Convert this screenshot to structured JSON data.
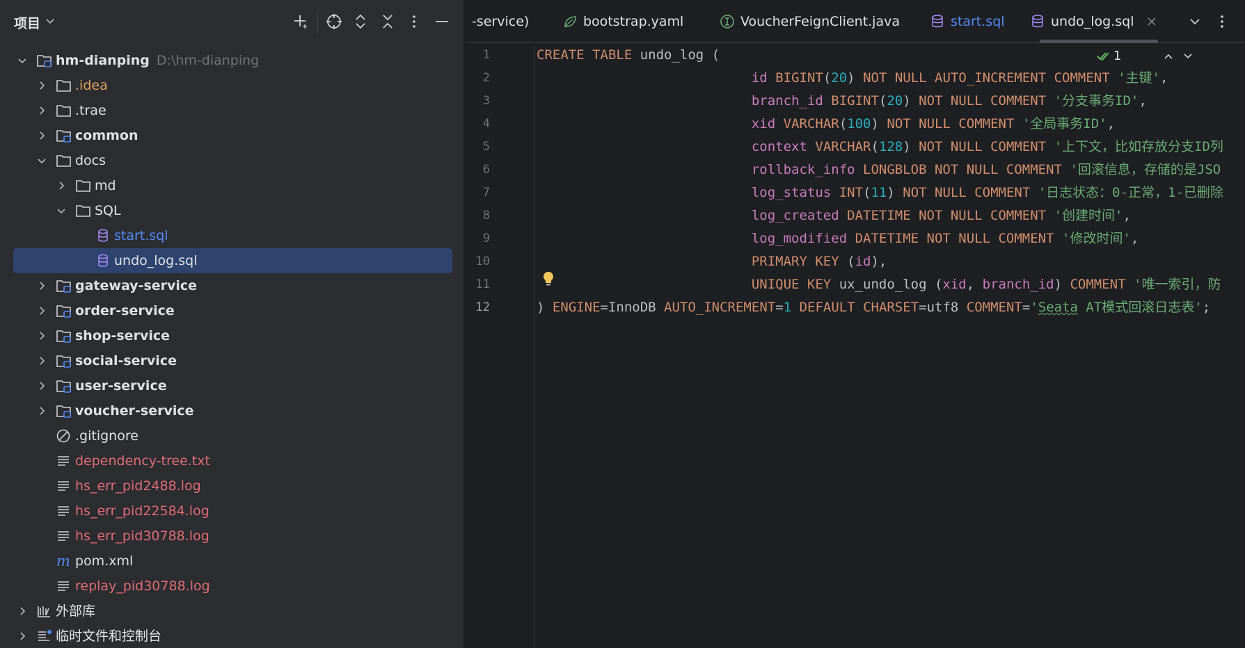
{
  "project": {
    "title": "项目",
    "root_name": "hm-dianping",
    "root_path": "D:\\hm-dianping",
    "items": [
      {
        "label": "hm-dianping",
        "icon": "module-folder-icon"
      },
      {
        "label": ".idea",
        "icon": "folder-icon",
        "color": "#e0a35f"
      },
      {
        "label": ".trae",
        "icon": "folder-icon",
        "color": "#dfe1e5"
      },
      {
        "label": "common",
        "icon": "module-folder-icon",
        "color": "#dfe1e5"
      },
      {
        "label": "docs",
        "icon": "folder-icon",
        "color": "#dfe1e5"
      },
      {
        "label": "md",
        "icon": "folder-icon",
        "color": "#dfe1e5"
      },
      {
        "label": "SQL",
        "icon": "folder-icon",
        "color": "#dfe1e5"
      },
      {
        "label": "start.sql",
        "icon": "database-icon",
        "color": "#548af7"
      },
      {
        "label": "undo_log.sql",
        "icon": "database-icon",
        "color": "#dfe1e5"
      },
      {
        "label": "gateway-service",
        "icon": "module-folder-icon",
        "color": "#dfe1e5"
      },
      {
        "label": "order-service",
        "icon": "module-folder-icon",
        "color": "#dfe1e5"
      },
      {
        "label": "shop-service",
        "icon": "module-folder-icon",
        "color": "#dfe1e5"
      },
      {
        "label": "social-service",
        "icon": "module-folder-icon",
        "color": "#dfe1e5"
      },
      {
        "label": "user-service",
        "icon": "module-folder-icon",
        "color": "#dfe1e5"
      },
      {
        "label": "voucher-service",
        "icon": "module-folder-icon",
        "color": "#dfe1e5"
      },
      {
        "label": ".gitignore",
        "icon": "ignore-icon",
        "color": "#dfe1e5"
      },
      {
        "label": "dependency-tree.txt",
        "icon": "text-file-icon",
        "color": "#e06c75"
      },
      {
        "label": "hs_err_pid2488.log",
        "icon": "text-file-icon",
        "color": "#e06c75"
      },
      {
        "label": "hs_err_pid22584.log",
        "icon": "text-file-icon",
        "color": "#e06c75"
      },
      {
        "label": "hs_err_pid30788.log",
        "icon": "text-file-icon",
        "color": "#e06c75"
      },
      {
        "label": "pom.xml",
        "icon": "maven-icon",
        "color": "#dfe1e5"
      },
      {
        "label": "replay_pid30788.log",
        "icon": "text-file-icon",
        "color": "#e06c75"
      },
      {
        "label": "外部库",
        "icon": "library-icon",
        "color": "#dfe1e5"
      },
      {
        "label": "临时文件和控制台",
        "icon": "scratches-icon",
        "color": "#dfe1e5"
      }
    ]
  },
  "tabs": [
    {
      "label": "-service)",
      "icon": "none",
      "color": "#dfe1e5"
    },
    {
      "label": "bootstrap.yaml",
      "icon": "spring-icon",
      "color": "#dfe1e5"
    },
    {
      "label": "VoucherFeignClient.java",
      "icon": "interface-icon",
      "color": "#dfe1e5"
    },
    {
      "label": "start.sql",
      "icon": "database-icon",
      "color": "#548af7"
    },
    {
      "label": "undo_log.sql",
      "icon": "database-icon",
      "color": "#dfe1e5"
    }
  ],
  "editor": {
    "inspection_count": "1",
    "line_numbers": [
      "1",
      "2",
      "3",
      "4",
      "5",
      "6",
      "7",
      "8",
      "9",
      "10",
      "11",
      "12"
    ],
    "lines": [
      [
        {
          "t": "CREATE TABLE ",
          "c": "kw"
        },
        {
          "t": "undo_log (",
          "c": "plain"
        }
      ],
      [
        {
          "t": "id ",
          "c": "col"
        },
        {
          "t": "BIGINT",
          "c": "kw"
        },
        {
          "t": "(",
          "c": "plain"
        },
        {
          "t": "20",
          "c": "num"
        },
        {
          "t": ") ",
          "c": "plain"
        },
        {
          "t": "NOT NULL AUTO_INCREMENT COMMENT ",
          "c": "kw"
        },
        {
          "t": "'主键'",
          "c": "str"
        },
        {
          "t": ",",
          "c": "plain"
        }
      ],
      [
        {
          "t": "branch_id ",
          "c": "col"
        },
        {
          "t": "BIGINT",
          "c": "kw"
        },
        {
          "t": "(",
          "c": "plain"
        },
        {
          "t": "20",
          "c": "num"
        },
        {
          "t": ") ",
          "c": "plain"
        },
        {
          "t": "NOT NULL COMMENT ",
          "c": "kw"
        },
        {
          "t": "'分支事务ID'",
          "c": "str"
        },
        {
          "t": ",",
          "c": "plain"
        }
      ],
      [
        {
          "t": "xid ",
          "c": "col"
        },
        {
          "t": "VARCHAR",
          "c": "kw"
        },
        {
          "t": "(",
          "c": "plain"
        },
        {
          "t": "100",
          "c": "num"
        },
        {
          "t": ") ",
          "c": "plain"
        },
        {
          "t": "NOT NULL COMMENT ",
          "c": "kw"
        },
        {
          "t": "'全局事务ID'",
          "c": "str"
        },
        {
          "t": ",",
          "c": "plain"
        }
      ],
      [
        {
          "t": "context ",
          "c": "col"
        },
        {
          "t": "VARCHAR",
          "c": "kw"
        },
        {
          "t": "(",
          "c": "plain"
        },
        {
          "t": "128",
          "c": "num"
        },
        {
          "t": ") ",
          "c": "plain"
        },
        {
          "t": "NOT NULL COMMENT ",
          "c": "kw"
        },
        {
          "t": "'上下文，比如存放分支ID列",
          "c": "str"
        }
      ],
      [
        {
          "t": "rollback_info ",
          "c": "col"
        },
        {
          "t": "LONGBLOB NOT NULL COMMENT ",
          "c": "kw"
        },
        {
          "t": "'回滚信息，存储的是JSO",
          "c": "str"
        }
      ],
      [
        {
          "t": "log_status ",
          "c": "col"
        },
        {
          "t": "INT",
          "c": "kw"
        },
        {
          "t": "(",
          "c": "plain"
        },
        {
          "t": "11",
          "c": "num"
        },
        {
          "t": ") ",
          "c": "plain"
        },
        {
          "t": "NOT NULL COMMENT ",
          "c": "kw"
        },
        {
          "t": "'日志状态：0-正常，1-已删除",
          "c": "str"
        }
      ],
      [
        {
          "t": "log_created ",
          "c": "col"
        },
        {
          "t": "DATETIME NOT NULL COMMENT ",
          "c": "kw"
        },
        {
          "t": "'创建时间'",
          "c": "str"
        },
        {
          "t": ",",
          "c": "plain"
        }
      ],
      [
        {
          "t": "log_modified ",
          "c": "col"
        },
        {
          "t": "DATETIME NOT NULL COMMENT ",
          "c": "kw"
        },
        {
          "t": "'修改时间'",
          "c": "str"
        },
        {
          "t": ",",
          "c": "plain"
        }
      ],
      [
        {
          "t": "PRIMARY KEY ",
          "c": "kw"
        },
        {
          "t": "(",
          "c": "plain"
        },
        {
          "t": "id",
          "c": "col"
        },
        {
          "t": "),",
          "c": "plain"
        }
      ],
      [
        {
          "t": "UNIQUE KEY ",
          "c": "kw"
        },
        {
          "t": "ux_undo_log (",
          "c": "plain"
        },
        {
          "t": "xid",
          "c": "col"
        },
        {
          "t": ", ",
          "c": "plain"
        },
        {
          "t": "branch_id",
          "c": "col"
        },
        {
          "t": ") ",
          "c": "plain"
        },
        {
          "t": "COMMENT ",
          "c": "kw"
        },
        {
          "t": "'唯一索引，防",
          "c": "str"
        }
      ],
      [
        {
          "t": ") ",
          "c": "plain"
        },
        {
          "t": "ENGINE",
          "c": "kw"
        },
        {
          "t": "=InnoDB ",
          "c": "plain"
        },
        {
          "t": "AUTO_INCREMENT",
          "c": "kw"
        },
        {
          "t": "=",
          "c": "plain"
        },
        {
          "t": "1",
          "c": "num"
        },
        {
          "t": " ",
          "c": "plain"
        },
        {
          "t": "DEFAULT CHARSET",
          "c": "kw"
        },
        {
          "t": "=utf8 ",
          "c": "plain"
        },
        {
          "t": "COMMENT",
          "c": "kw"
        },
        {
          "t": "=",
          "c": "plain"
        },
        {
          "t": "'",
          "c": "str"
        },
        {
          "t": "Seata",
          "c": "str squig"
        },
        {
          "t": " AT模式回滚日志表'",
          "c": "str"
        },
        {
          "t": ";",
          "c": "plain"
        }
      ]
    ]
  }
}
